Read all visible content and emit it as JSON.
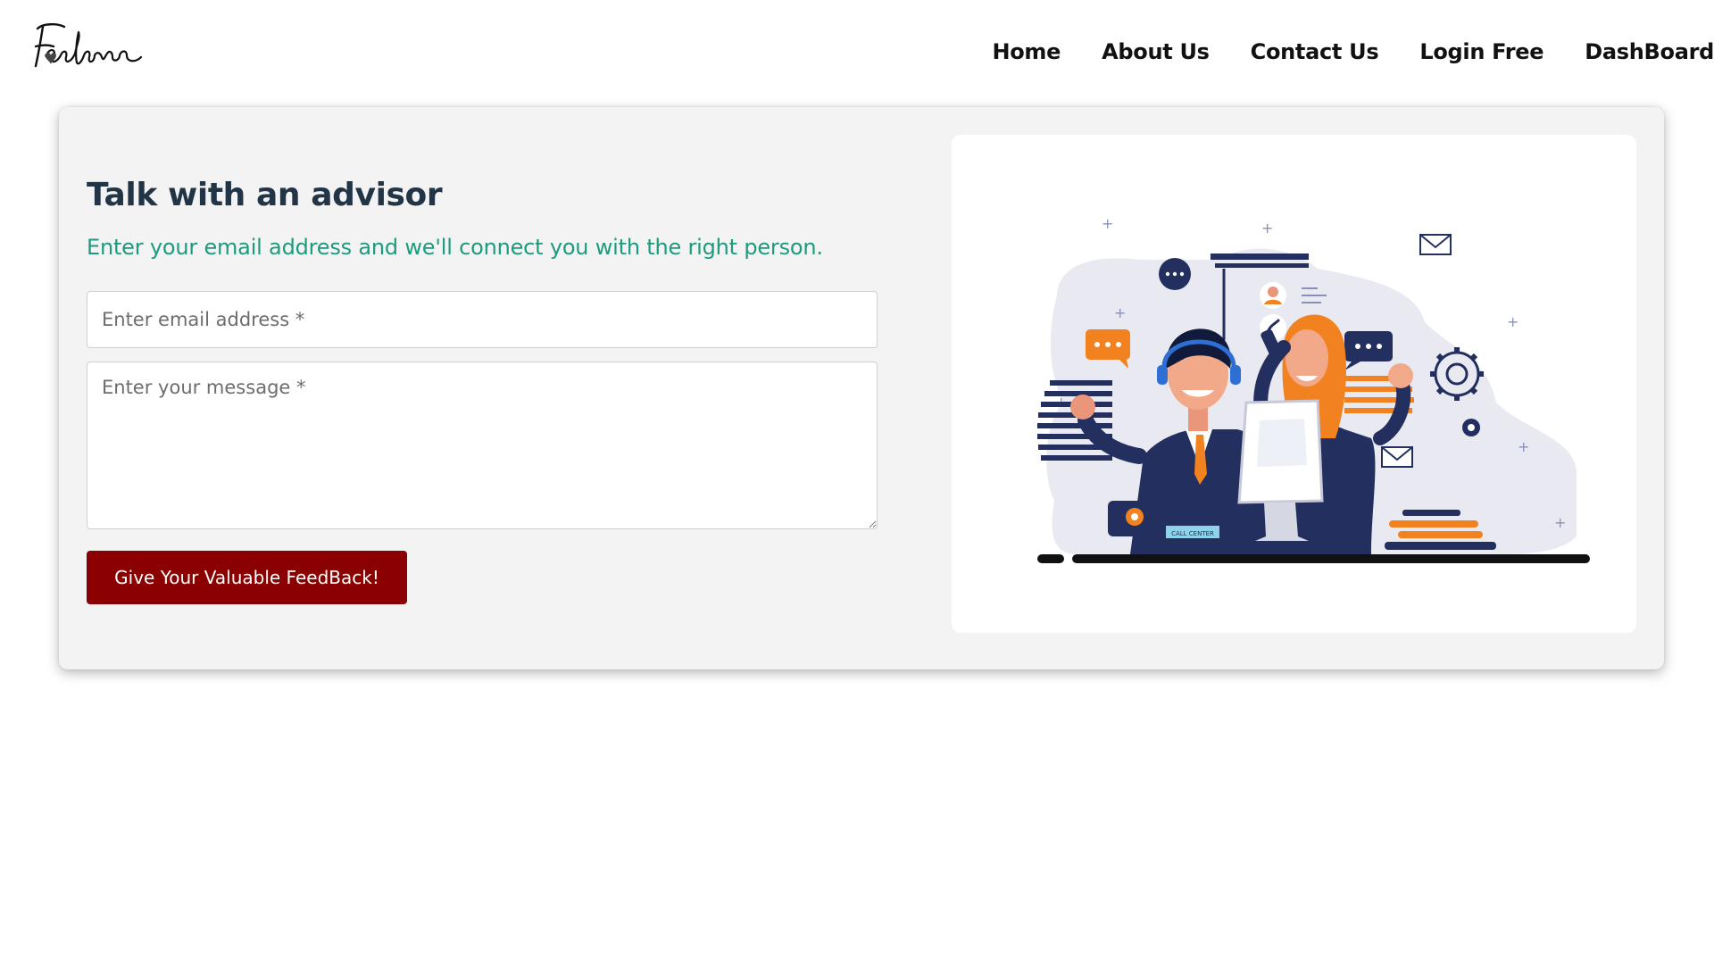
{
  "header": {
    "logo_icon": "freelance-script-logo",
    "nav": [
      {
        "label": "Home"
      },
      {
        "label": "About Us"
      },
      {
        "label": "Contact Us"
      },
      {
        "label": "Login Free"
      },
      {
        "label": "DashBoard"
      }
    ]
  },
  "form": {
    "title": "Talk with an advisor",
    "subtitle": "Enter your email address and we'll connect you with the right person.",
    "email_placeholder": "Enter email address *",
    "email_value": "",
    "message_placeholder": "Enter your message *",
    "message_value": "",
    "submit_label": "Give Your Valuable FeedBack!"
  },
  "illustration": {
    "icon": "call-center-advisors-illustration",
    "sign_text": "CALL CENTER"
  },
  "colors": {
    "title": "#213547",
    "subtitle": "#1c9b7e",
    "button": "#8b0000",
    "card_bg": "#f3f3f3",
    "navy": "#232f5e",
    "orange": "#f28220"
  }
}
